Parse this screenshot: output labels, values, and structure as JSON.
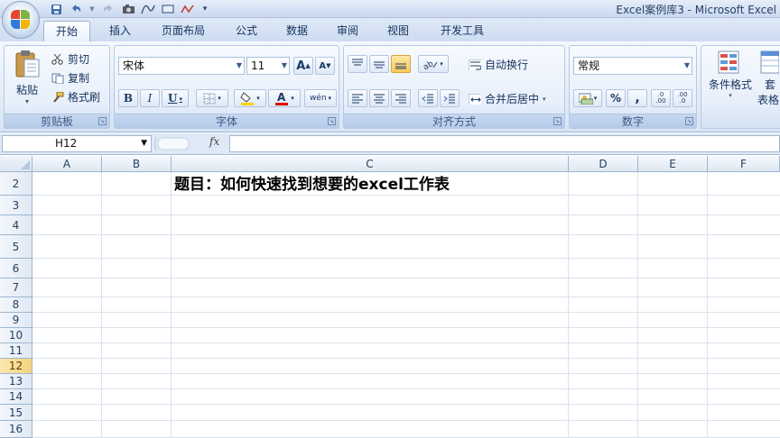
{
  "window": {
    "title": "Excel案例库3 - Microsoft Excel"
  },
  "quick_access": {
    "icons": [
      "save-icon",
      "undo-icon",
      "redo-icon",
      "camera-icon",
      "shapes-icon",
      "customize-icon"
    ]
  },
  "tabs": [
    {
      "label": "开始",
      "active": true
    },
    {
      "label": "插入"
    },
    {
      "label": "页面布局"
    },
    {
      "label": "公式"
    },
    {
      "label": "数据"
    },
    {
      "label": "审阅"
    },
    {
      "label": "视图"
    },
    {
      "label": "开发工具"
    }
  ],
  "ribbon": {
    "clipboard": {
      "label": "剪贴板",
      "paste": "粘贴",
      "cut": "剪切",
      "copy": "复制",
      "format_painter": "格式刷"
    },
    "font": {
      "label": "字体",
      "font_name": "宋体",
      "font_size": "11",
      "bold": "B",
      "italic": "I",
      "underline": "U",
      "grow": "A",
      "shrink": "A",
      "phonetic": "wén",
      "font_color": "#e00000",
      "fill_color": "#ffd400"
    },
    "alignment": {
      "label": "对齐方式",
      "wrap": "自动换行",
      "merge": "合并后居中"
    },
    "number": {
      "label": "数字",
      "format": "常规",
      "percent": "%",
      "comma": ",",
      "inc_decimal": ".0 .00",
      "dec_decimal": ".00 .0"
    },
    "styles": {
      "conditional": "条件格式",
      "table": "套",
      "table_line2": "表格"
    }
  },
  "formula_bar": {
    "name_box": "H12",
    "fx": "fx",
    "content": ""
  },
  "grid": {
    "columns": [
      "A",
      "B",
      "C",
      "D",
      "E",
      "F"
    ],
    "rows": [
      "2",
      "3",
      "4",
      "5",
      "6",
      "7",
      "8",
      "9",
      "10",
      "11",
      "12",
      "13",
      "14",
      "15",
      "16"
    ],
    "selected_row": "12",
    "cell_c2": "题目：如何快速找到想要的excel工作表"
  }
}
